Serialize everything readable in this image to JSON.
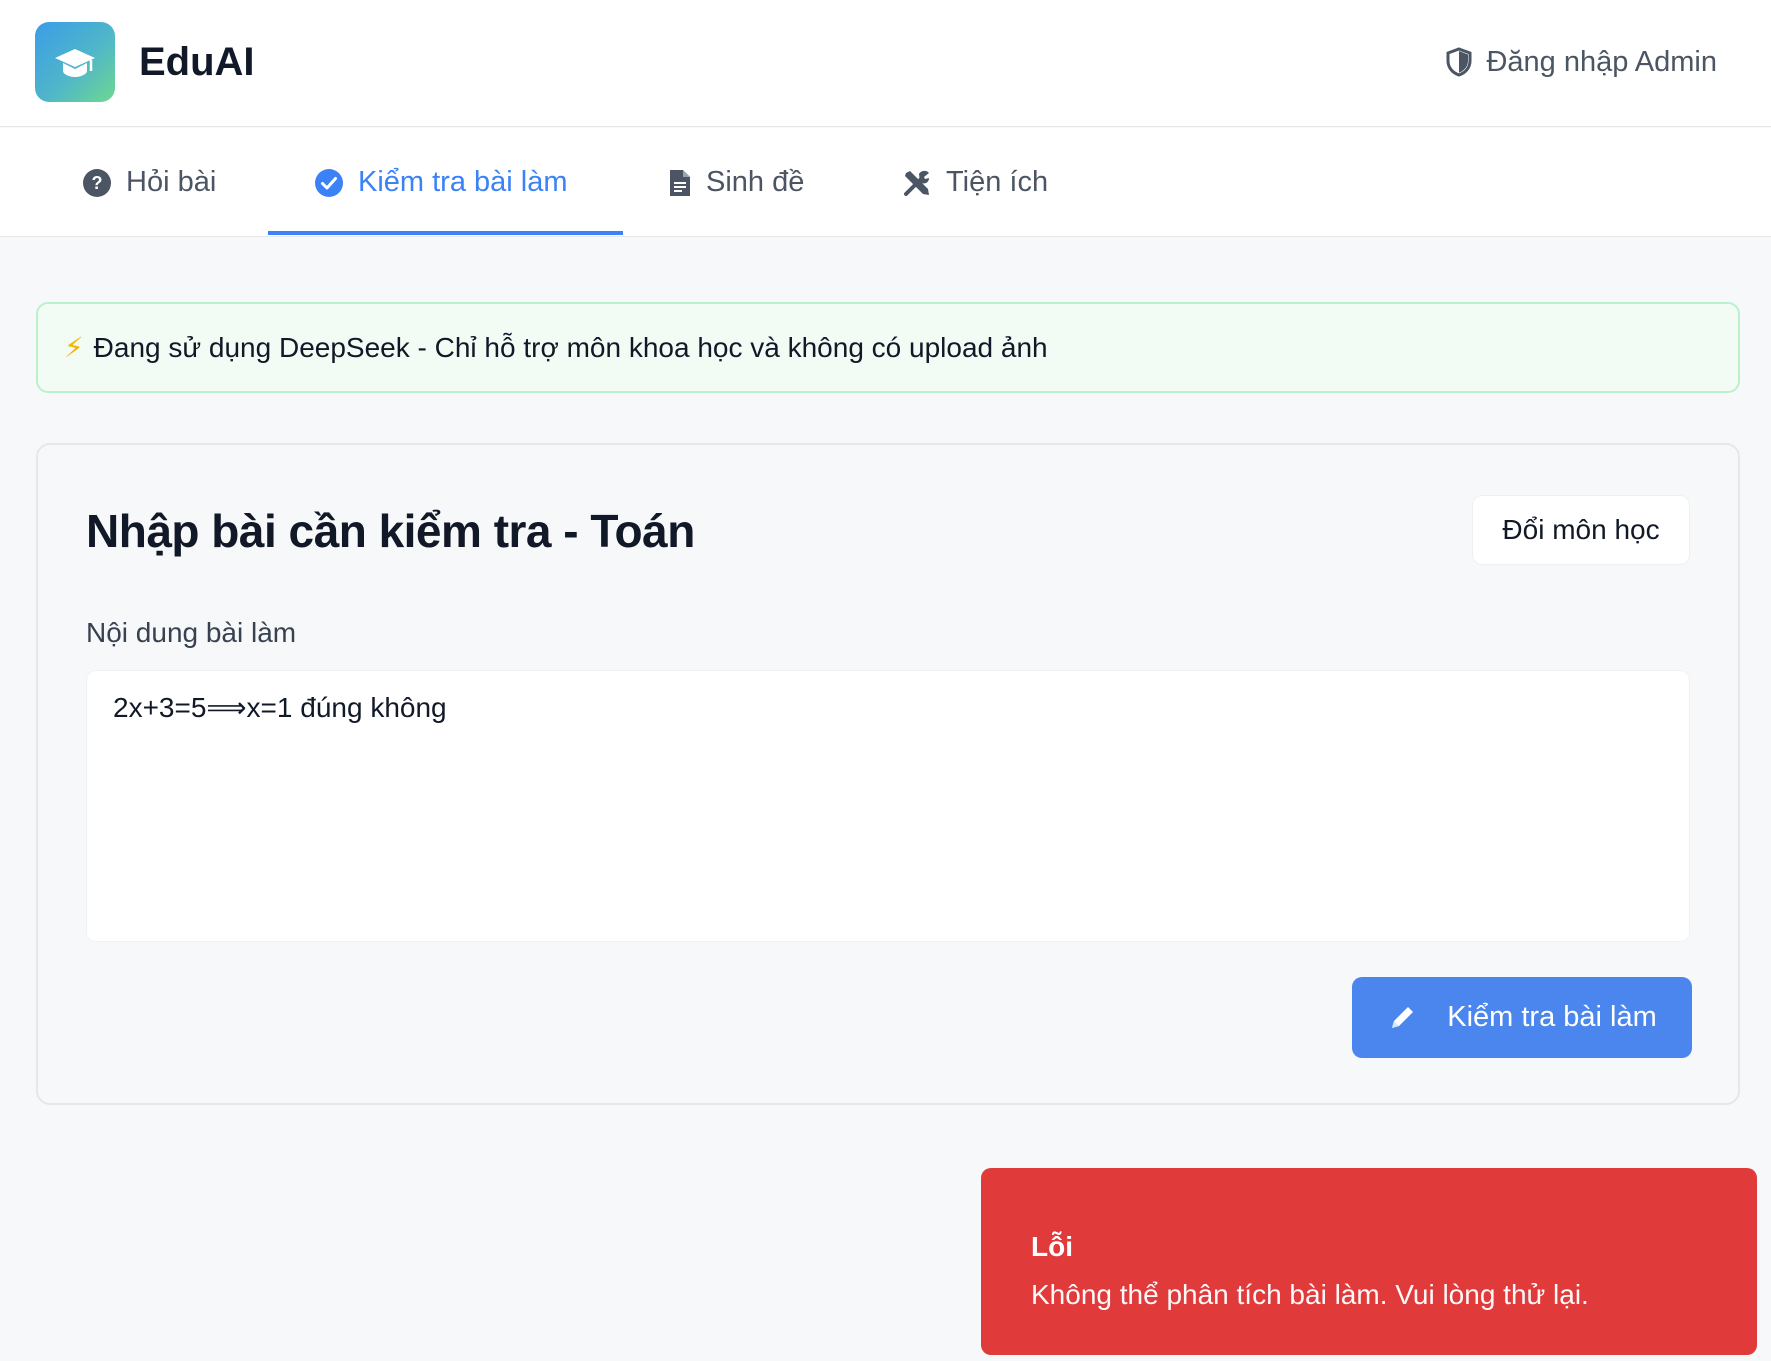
{
  "header": {
    "app_title": "EduAI",
    "admin_login_label": "Đăng nhập Admin"
  },
  "tabs": [
    {
      "label": "Hỏi bài",
      "icon": "question-circle-icon",
      "active": false
    },
    {
      "label": "Kiểm tra bài làm",
      "icon": "check-circle-icon",
      "active": true
    },
    {
      "label": "Sinh đề",
      "icon": "document-icon",
      "active": false
    },
    {
      "label": "Tiện ích",
      "icon": "tools-icon",
      "active": false
    }
  ],
  "notice": {
    "icon": "⚡",
    "text": "Đang sử dụng DeepSeek - Chỉ hỗ trợ môn khoa học và không có upload ảnh"
  },
  "card": {
    "title": "Nhập bài cần kiểm tra - Toán",
    "switch_subject_label": "Đổi môn học",
    "field_label": "Nội dung bài làm",
    "answer_value": "2x+3=5⟹x=1 đúng không",
    "check_button_label": "Kiểm tra bài làm"
  },
  "toast": {
    "title": "Lỗi",
    "message": "Không thể phân tích bài làm. Vui lòng thử lại."
  },
  "colors": {
    "accent": "#3b82f6",
    "button": "#4a86ee",
    "error": "#e03a3a",
    "notice_bg": "#f2fbf4",
    "notice_border": "#bbf0cc"
  }
}
